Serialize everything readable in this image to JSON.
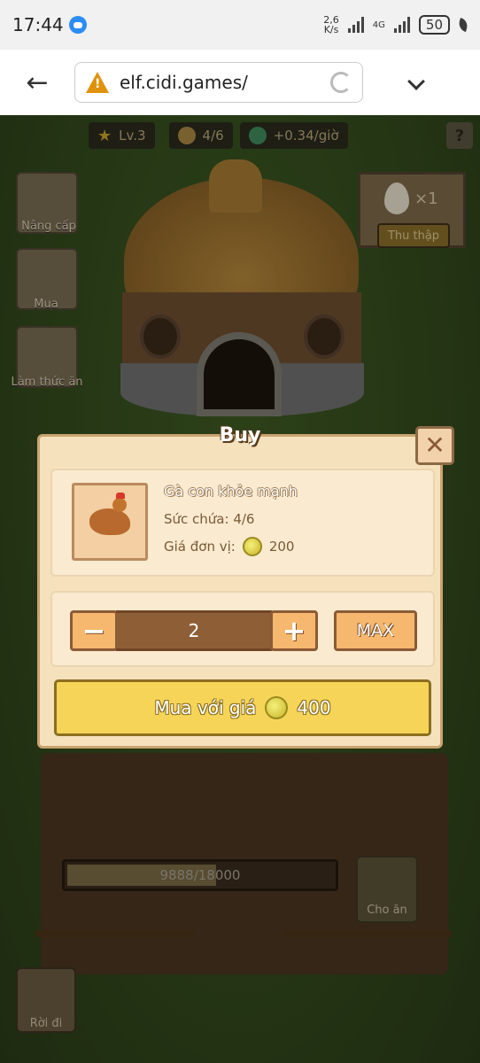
{
  "status_bar": {
    "time": "17:44",
    "net_speed_top": "2,6",
    "net_speed_bottom": "K/s",
    "lte": "4G",
    "battery": "50"
  },
  "browser": {
    "url": "elf.cidi.games/"
  },
  "game": {
    "stats": {
      "level": "Lv.3",
      "capacity": "4/6",
      "rate": "+0.34/giờ"
    },
    "help_label": "?",
    "side_buttons": {
      "upgrade": "Nâng cấp",
      "buy": "Mua",
      "make_food": "Làm thức ăn"
    },
    "egg_sign": {
      "count": "×1",
      "collect_label": "Thu thập"
    },
    "food_progress": {
      "text": "9888/18000",
      "fraction": 0.549
    },
    "feed_label": "Cho ăn",
    "exit_label": "Rời đi"
  },
  "modal": {
    "title": "Buy",
    "close_label": "✕",
    "product": {
      "name": "Gà con khỏe mạnh",
      "capacity": "Sức chứa: 4/6",
      "unit_price_label": "Giá đơn vị:",
      "unit_price": "200"
    },
    "quantity": {
      "minus": "−",
      "value": "2",
      "plus": "+",
      "max_label": "MAX"
    },
    "buy_button": {
      "label": "Mua với giá",
      "total": "400"
    }
  },
  "colors": {
    "modal_bg": "#f6e1bd",
    "buy_button": "#f5d458",
    "qty_button": "#f5b86e"
  }
}
